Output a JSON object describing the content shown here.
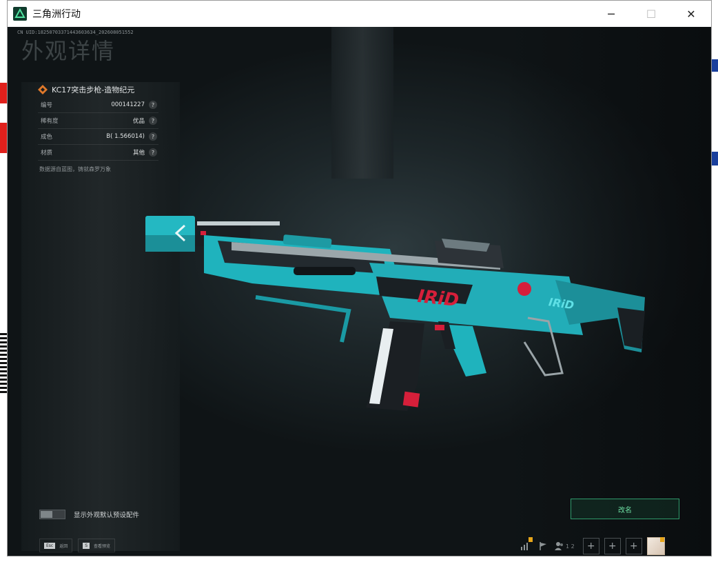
{
  "window": {
    "title": "三角洲行动",
    "controls": [
      "minimize",
      "maximize",
      "close"
    ]
  },
  "game": {
    "uid": "CN UID:18250703371443603634_202608051552",
    "page_title": "外观详情",
    "item": {
      "name": "KC17突击步枪-造物纪元",
      "rows": [
        {
          "label": "编号",
          "value": "000141227"
        },
        {
          "label": "稀有度",
          "value": "优品"
        },
        {
          "label": "成色",
          "value": "B( 1.566014)"
        },
        {
          "label": "材质",
          "value": "其他"
        }
      ],
      "description": "数据源自蓝图，铸就森罗万象"
    },
    "weapon_decal": "IRiD",
    "toggle_label": "显示外观默认预设配件",
    "rename_label": "改名",
    "hints": [
      {
        "key": "Esc",
        "text": "返回"
      },
      {
        "key": "S",
        "text": "查看预览"
      }
    ],
    "friends_count": "1 2",
    "colors": {
      "accent": "#6fe1a5",
      "weapon_teal": "#1fb3bd",
      "weapon_red": "#d61f3a"
    }
  }
}
